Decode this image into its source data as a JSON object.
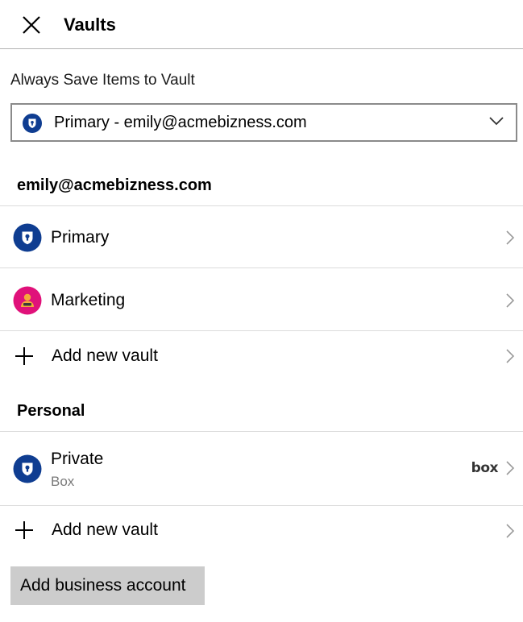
{
  "header": {
    "title": "Vaults",
    "close_icon": "close-icon"
  },
  "default_vault": {
    "label": "Always Save Items to Vault",
    "selected": "Primary - emily@acmebizness.com",
    "icon": "vault-shield-icon"
  },
  "sections": [
    {
      "heading": "emily@acmebizness.com",
      "items": [
        {
          "label": "Primary",
          "icon": "vault-shield-icon"
        },
        {
          "label": "Marketing",
          "icon": "person-avatar-icon"
        },
        {
          "label": "Add new vault",
          "icon": "plus-icon"
        }
      ]
    },
    {
      "heading": "Personal",
      "items": [
        {
          "label": "Private",
          "sublabel": "Box",
          "provider_logo": "box",
          "icon": "vault-shield-icon"
        },
        {
          "label": "Add new vault",
          "icon": "plus-icon"
        }
      ]
    }
  ],
  "footer": {
    "add_business_label": "Add business account"
  },
  "colors": {
    "vault_blue": "#0f3d91",
    "marketing_pink": "#e0117a",
    "button_gray": "#cccccc"
  }
}
